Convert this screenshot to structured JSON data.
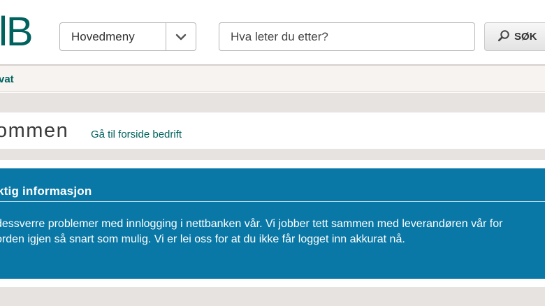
{
  "header": {
    "logo_text": "lB",
    "menu_label": "Hovedmeny",
    "search_placeholder": "Hva leter du etter?",
    "search_button_label": "SØK"
  },
  "nav": {
    "active_item": "vat"
  },
  "page": {
    "title": "ommen",
    "front_link": "Gå til forside bedrift"
  },
  "alert": {
    "title": "ktig informasjon",
    "line1": "dessverre problemer med innlogging i nettbanken vår. Vi jobber tett sammen med leverandøren vår for",
    "line2": "orden igjen så snart som mulig. Vi er lei oss for at du ikke får logget inn akkurat nå."
  },
  "colors": {
    "brand": "#00625e",
    "alert_bg": "#0a78a6",
    "band": "#e6e3e0"
  }
}
